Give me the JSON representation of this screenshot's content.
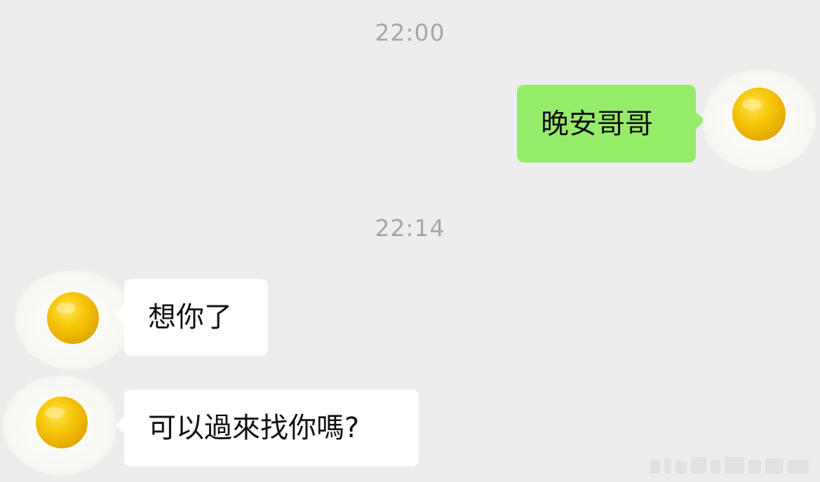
{
  "chat": {
    "messages": [
      {
        "type": "time",
        "text": "22:00"
      },
      {
        "type": "bubble",
        "side": "right",
        "text": "晚安哥哥",
        "avatar": "fried-egg-icon"
      },
      {
        "type": "time",
        "text": "22:14"
      },
      {
        "type": "bubble",
        "side": "left",
        "text": "想你了",
        "avatar": "fried-egg-icon"
      },
      {
        "type": "bubble",
        "side": "left",
        "text": "可以過來找你嗎?",
        "avatar": "fried-egg-icon"
      }
    ]
  },
  "colors": {
    "background": "#ededed",
    "outgoing_bubble": "#95ec69",
    "incoming_bubble": "#ffffff",
    "timestamp_text": "#a6a6a6",
    "egg_white": "#fbfbf8",
    "egg_yolk": "#f5c000"
  }
}
